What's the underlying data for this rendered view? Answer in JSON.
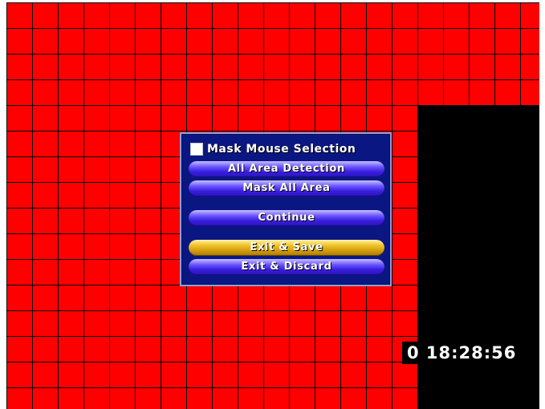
{
  "overlay": {
    "timestamp": "0  18:28:56"
  },
  "mask_grid": {
    "columns": 21,
    "rows": 16,
    "fill_color": "#ff0000"
  },
  "menu": {
    "mask_mouse_selection": {
      "label": "Mask Mouse Selection",
      "checked": false
    },
    "buttons": {
      "all_area_detection": "All Area Detection",
      "mask_all_area": "Mask All Area",
      "continue": "Continue",
      "exit_save": "Exit & Save",
      "exit_discard": "Exit & Discard"
    },
    "highlighted": "exit_save",
    "colors": {
      "panel": "#0a1782",
      "button": "#3a20e0",
      "highlight": "#f0c22a"
    }
  }
}
